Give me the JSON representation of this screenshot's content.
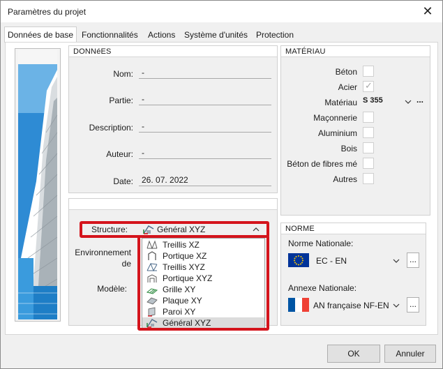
{
  "window": {
    "title": "Paramètres du projet",
    "close_glyph": "✕"
  },
  "tabs": [
    {
      "label": "Données de base"
    },
    {
      "label": "Fonctionnalités"
    },
    {
      "label": "Actions"
    },
    {
      "label": "Système d'unités"
    },
    {
      "label": "Protection"
    }
  ],
  "donnees": {
    "header": "DONNéES",
    "nom_label": "Nom:",
    "nom_value": "-",
    "partie_label": "Partie:",
    "partie_value": "-",
    "description_label": "Description:",
    "description_value": "-",
    "auteur_label": "Auteur:",
    "auteur_value": "-",
    "date_label": "Date:",
    "date_value": "26. 07. 2022"
  },
  "structure_section": {
    "structure_label": "Structure:",
    "structure_value": "Général XYZ",
    "environnement_label": "Environnement",
    "environnement_label2": "de",
    "modele_label": "Modèle:"
  },
  "structure_options": [
    {
      "label": "Treillis XZ",
      "icon": "truss-xz-icon"
    },
    {
      "label": "Portique XZ",
      "icon": "frame-xz-icon"
    },
    {
      "label": "Treillis XYZ",
      "icon": "truss-xyz-icon"
    },
    {
      "label": "Portique XYZ",
      "icon": "frame-xyz-icon"
    },
    {
      "label": "Grille XY",
      "icon": "grid-xy-icon"
    },
    {
      "label": "Plaque XY",
      "icon": "plate-xy-icon"
    },
    {
      "label": "Paroi XY",
      "icon": "wall-xy-icon"
    },
    {
      "label": "Général XYZ",
      "icon": "general-xyz-icon"
    }
  ],
  "materiau": {
    "header": "MATÉRIAU",
    "beton_label": "Béton",
    "beton_checked": false,
    "acier_label": "Acier",
    "acier_checked": true,
    "materiau_label": "Matériau",
    "materiau_value": "S 355",
    "materiau_more": "...",
    "maconnerie_label": "Maçonnerie",
    "maconnerie_checked": false,
    "aluminium_label": "Aluminium",
    "aluminium_checked": false,
    "bois_label": "Bois",
    "bois_checked": false,
    "beton_fibres_label": "Béton de fibres mé",
    "beton_fibres_checked": false,
    "autres_label": "Autres",
    "autres_checked": false
  },
  "norme": {
    "header": "NORME",
    "nationale_label": "Norme Nationale:",
    "nationale_value": "EC - EN",
    "annexe_label": "Annexe Nationale:",
    "annexe_value": "AN française NF-EN",
    "more": "..."
  },
  "footer": {
    "ok_label": "OK",
    "cancel_label": "Annuler"
  },
  "colors": {
    "highlight_red": "#d4141c",
    "eu_blue": "#003399",
    "eu_gold": "#ffcc00",
    "fr_blue": "#0055a4",
    "fr_red": "#ef4135"
  }
}
